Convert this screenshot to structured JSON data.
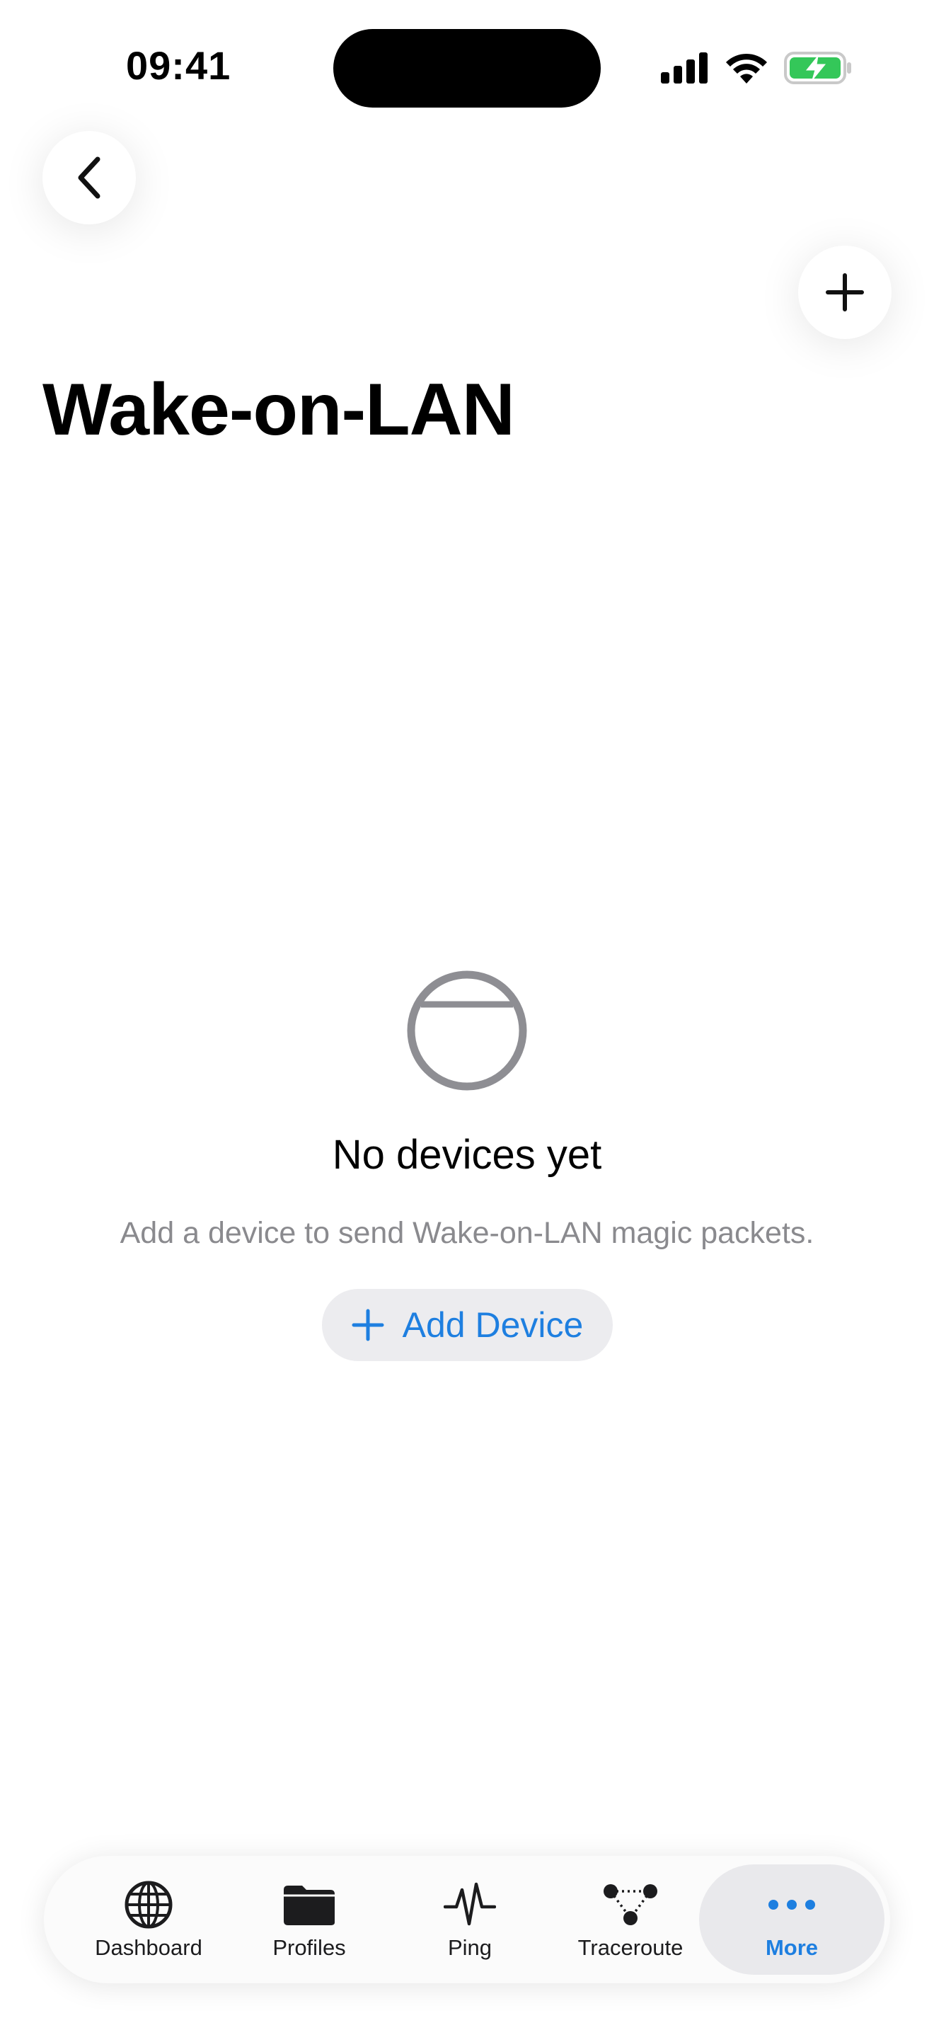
{
  "status_bar": {
    "time": "09:41",
    "icons": [
      "cellular-signal-icon",
      "wifi-icon",
      "battery-charging-icon"
    ],
    "battery_color": "#34c759"
  },
  "nav": {
    "back_icon": "chevron-left-icon",
    "add_icon": "plus-icon"
  },
  "page": {
    "title": "Wake-on-LAN"
  },
  "empty_state": {
    "icon": "empty-circle-icon",
    "title": "No devices yet",
    "subtitle": "Add a device to send Wake-on-LAN magic packets.",
    "button_label": "Add Device",
    "button_icon": "plus-icon"
  },
  "tab_bar": {
    "active_tab": "More",
    "accent_color": "#1e7fe0",
    "tabs": [
      {
        "label": "Dashboard",
        "icon": "globe-icon"
      },
      {
        "label": "Profiles",
        "icon": "folder-icon"
      },
      {
        "label": "Ping",
        "icon": "waveform-icon"
      },
      {
        "label": "Traceroute",
        "icon": "network-nodes-icon"
      },
      {
        "label": "More",
        "icon": "ellipsis-icon"
      }
    ]
  }
}
